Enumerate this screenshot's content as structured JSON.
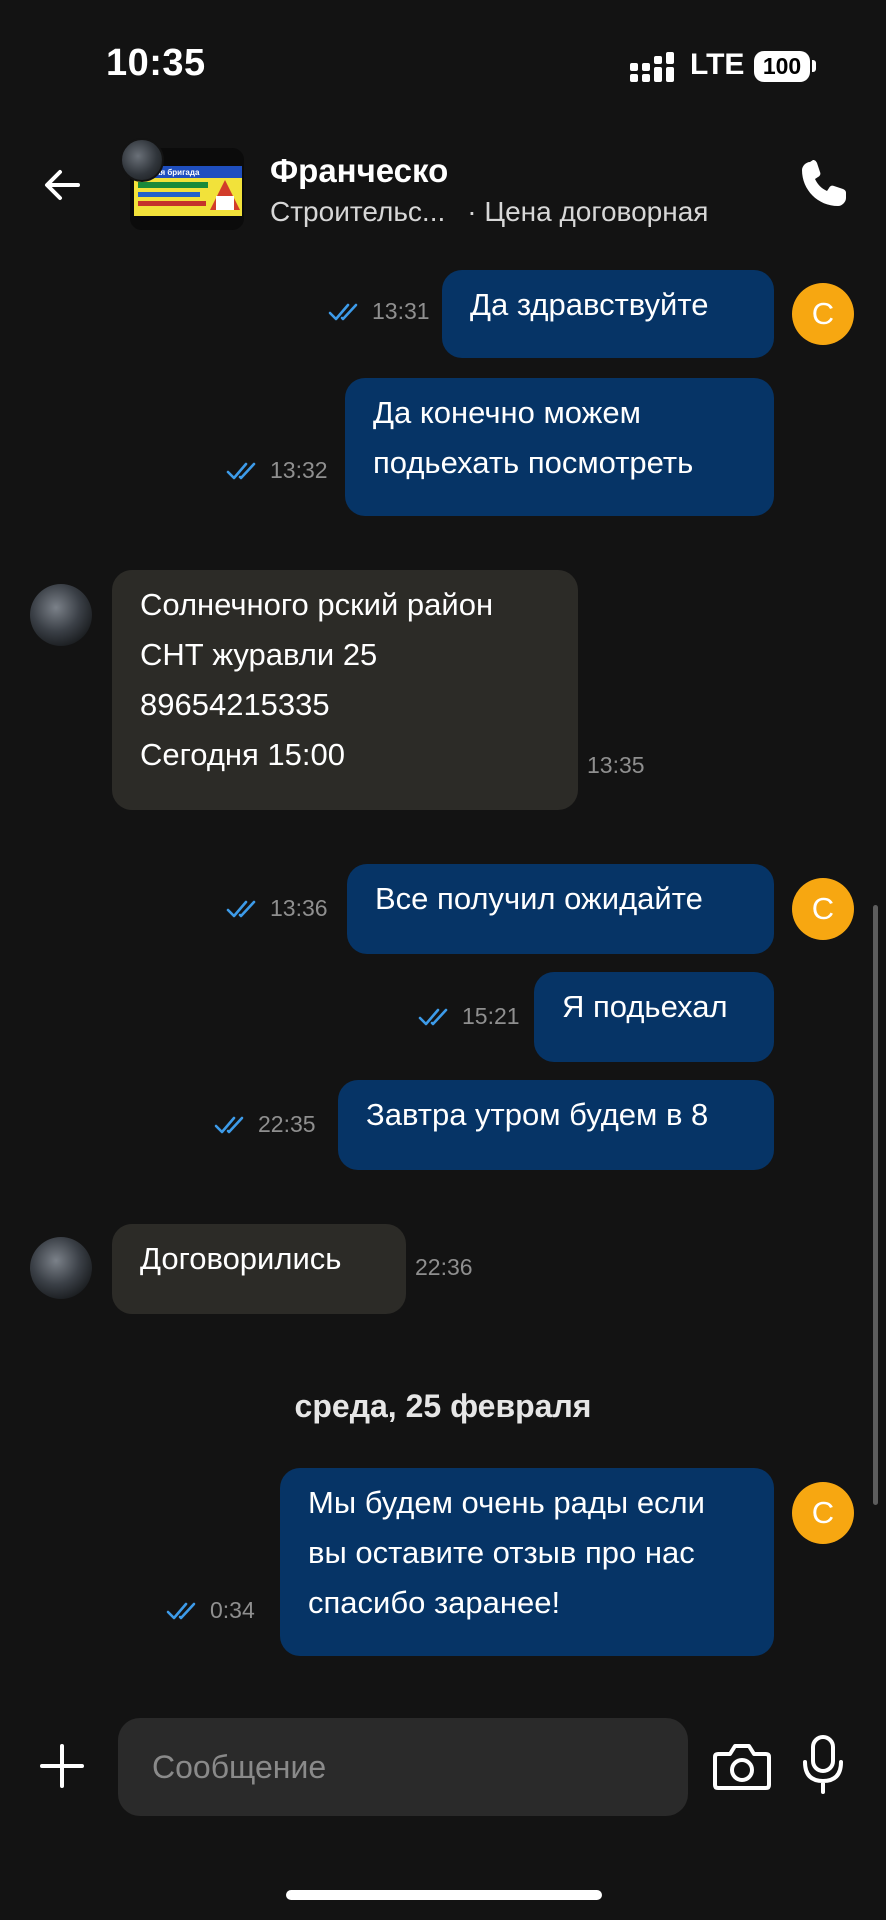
{
  "status_bar": {
    "time": "10:35",
    "network": "LTE",
    "battery": "100"
  },
  "header": {
    "name": "Франческо",
    "subtitle_service": "Строительс...",
    "subtitle_price": "· Цена договорная",
    "avatar_banner_text": "ая бригада"
  },
  "messages": [
    {
      "dir": "out",
      "text": "Да здравствуйте",
      "time": "13:31",
      "read": true,
      "avatar": "С"
    },
    {
      "dir": "out",
      "text": "Да конечно  можем\nподьехать посмотреть",
      "time": "13:32",
      "read": true
    },
    {
      "dir": "in",
      "text": "Солнечного рский район\nСНТ журавли 25\n89654215335\nСегодня 15:00",
      "time": "13:35"
    },
    {
      "dir": "out",
      "text": "Все получил ожидайте",
      "time": "13:36",
      "read": true,
      "avatar": "С"
    },
    {
      "dir": "out",
      "text": "Я подьехал",
      "time": "15:21",
      "read": true
    },
    {
      "dir": "out",
      "text": "Завтра утром будем в 8",
      "time": "22:35",
      "read": true
    },
    {
      "dir": "in",
      "text": "Договорились",
      "time": "22:36"
    },
    {
      "dir": "out",
      "text": "Мы будем очень рады если\nвы оставите отзыв про нас\nспасибо заранее!",
      "time": "0:34",
      "read": true,
      "avatar": "С"
    }
  ],
  "date_separator": "среда, 25 февраля",
  "composer": {
    "placeholder": "Сообщение"
  },
  "colors": {
    "background": "#131313",
    "outgoing_bubble": "#063466",
    "incoming_bubble": "#2c2b27",
    "read_check": "#3d9be9",
    "my_avatar": "#f7a711"
  },
  "icons": {
    "back": "arrow-left-icon",
    "call": "phone-icon",
    "attach": "plus-icon",
    "camera": "camera-icon",
    "mic": "microphone-icon",
    "read": "double-check-icon"
  }
}
